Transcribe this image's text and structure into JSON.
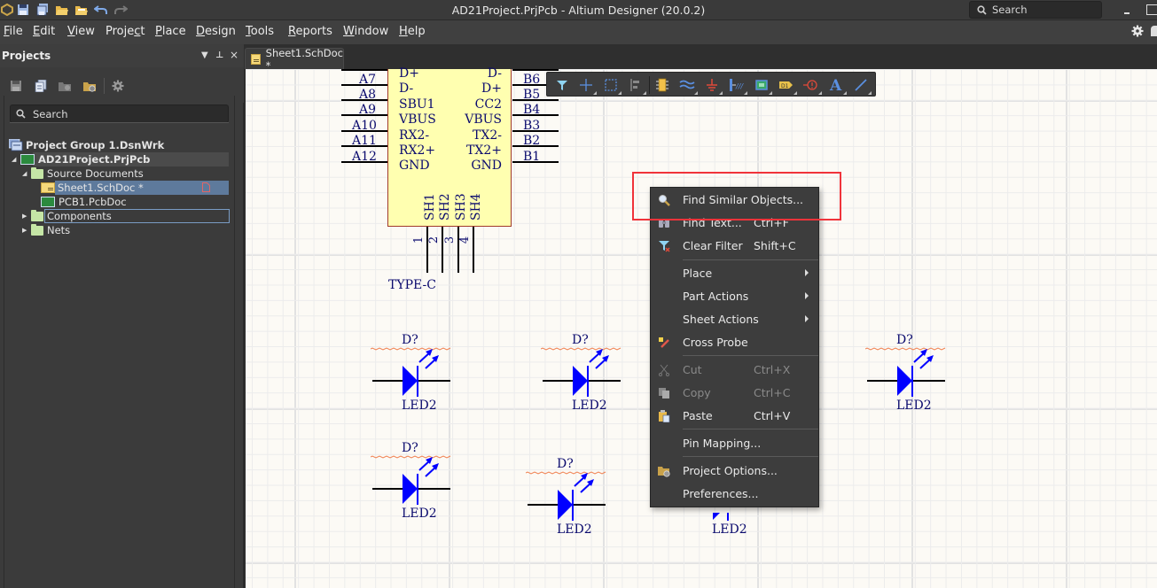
{
  "window": {
    "title": "AD21Project.PrjPcb - Altium Designer (20.0.2)",
    "search_placeholder": "Search"
  },
  "menubar": {
    "items": [
      {
        "label": "File",
        "mnemonic": "F"
      },
      {
        "label": "Edit",
        "mnemonic": "E"
      },
      {
        "label": "View",
        "mnemonic": "V"
      },
      {
        "label": "Project",
        "mnemonic": "c"
      },
      {
        "label": "Place",
        "mnemonic": "P"
      },
      {
        "label": "Design",
        "mnemonic": "D"
      },
      {
        "label": "Tools",
        "mnemonic": "T"
      },
      {
        "label": "Reports",
        "mnemonic": "R"
      },
      {
        "label": "Window",
        "mnemonic": "W"
      },
      {
        "label": "Help",
        "mnemonic": "H"
      }
    ]
  },
  "document_tab": {
    "label": "Sheet1.SchDoc *"
  },
  "projects_panel": {
    "title": "Projects",
    "search_placeholder": "Search",
    "tree": [
      {
        "label": "Project Group 1.DsnWrk",
        "level": 0,
        "icon": "workspace-icon",
        "bold": true
      },
      {
        "label": "AD21Project.PrjPcb",
        "level": 1,
        "icon": "pcb-project-icon",
        "bold": true,
        "expanded": true
      },
      {
        "label": "Source Documents",
        "level": 2,
        "icon": "folder-icon",
        "expanded": true
      },
      {
        "label": "Sheet1.SchDoc *",
        "level": 3,
        "icon": "schematic-icon",
        "selected": true,
        "modified_icon": "document-modified-icon"
      },
      {
        "label": "PCB1.PcbDoc",
        "level": 3,
        "icon": "pcb-icon"
      },
      {
        "label": "Components",
        "level": 2,
        "icon": "folder-icon",
        "expanded": false,
        "focused": true
      },
      {
        "label": "Nets",
        "level": 2,
        "icon": "folder-icon",
        "expanded": false
      }
    ]
  },
  "active_bar": {
    "tools": [
      "filter-icon",
      "crosshair-icon",
      "select-rectangle-icon",
      "align-icon",
      "component-icon",
      "harness-icon",
      "ground-power-icon",
      "port-icon",
      "sheet-symbol-icon",
      "net-label-icon",
      "directive-icon",
      "text-icon",
      "wire-icon"
    ]
  },
  "schematic": {
    "connector": {
      "designator": "TYPE-C",
      "left_pins": [
        "A7",
        "A8",
        "A9",
        "A10",
        "A11",
        "A12"
      ],
      "left_names": [
        "D+",
        "D-",
        "SBU1",
        "VBUS",
        "RX2-",
        "RX2+",
        "GND"
      ],
      "right_names": [
        "D-",
        "D+",
        "CC2",
        "VBUS",
        "TX2-",
        "TX2+",
        "GND"
      ],
      "right_pins": [
        "B6",
        "B5",
        "B4",
        "B3",
        "B2",
        "B1"
      ],
      "bottom_names": [
        "SH1",
        "SH2",
        "SH3",
        "SH4"
      ],
      "bottom_pins": [
        "1",
        "2",
        "3",
        "4"
      ]
    },
    "leds": [
      {
        "designator": "D?",
        "comment": "LED2"
      },
      {
        "designator": "D?",
        "comment": "LED2"
      },
      {
        "designator": "D?",
        "comment": "LED2"
      },
      {
        "designator": "D?",
        "comment": "LED2"
      },
      {
        "designator": "D?",
        "comment": "LED2"
      },
      {
        "designator": "D?",
        "comment": "LED2"
      }
    ],
    "colors": {
      "sheet_bg": "#fcfaf5",
      "component_fill": "#ffffb0",
      "component_border": "#a03a2a",
      "text": "#0b0b6e",
      "led_blue": "#0000ff",
      "wire": "#000000",
      "error_squiggle": "#f08050"
    }
  },
  "context_menu": {
    "items": [
      {
        "label": "Find Similar Objects...",
        "icon": "magnifier-icon",
        "shortcut": ""
      },
      {
        "label": "Find Text...",
        "icon": "binoculars-icon",
        "shortcut": "Ctrl+F"
      },
      {
        "label": "Clear Filter",
        "icon": "clear-filter-icon",
        "shortcut": "Shift+C"
      },
      {
        "label": "Place",
        "submenu": true
      },
      {
        "label": "Part Actions",
        "submenu": true
      },
      {
        "label": "Sheet Actions",
        "submenu": true
      },
      {
        "label": "Cross Probe",
        "icon": "cross-probe-icon"
      },
      {
        "label": "Cut",
        "icon": "scissors-icon",
        "shortcut": "Ctrl+X",
        "disabled": true
      },
      {
        "label": "Copy",
        "icon": "copy-icon",
        "shortcut": "Ctrl+C",
        "disabled": true
      },
      {
        "label": "Paste",
        "icon": "paste-icon",
        "shortcut": "Ctrl+V"
      },
      {
        "label": "Pin Mapping..."
      },
      {
        "label": "Project Options...",
        "icon": "project-options-icon"
      },
      {
        "label": "Preferences..."
      }
    ],
    "highlight_color": "#f0333a"
  }
}
